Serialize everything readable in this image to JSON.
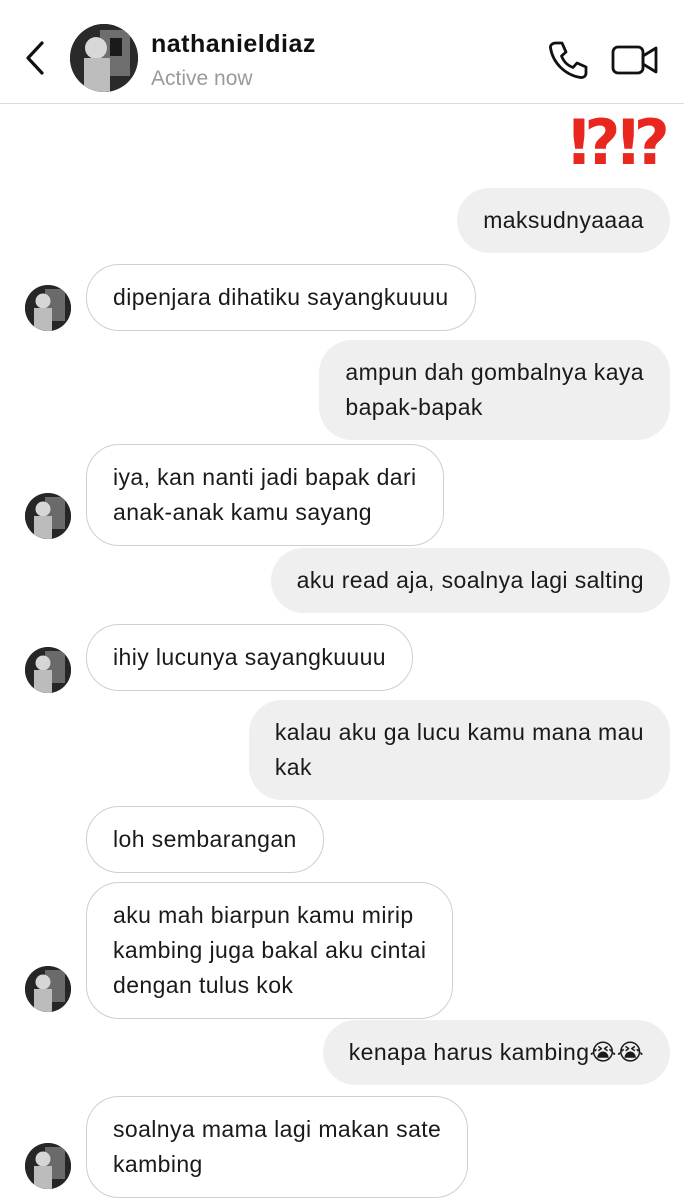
{
  "header": {
    "contact_name": "nathanieldiaz",
    "status": "Active now"
  },
  "reaction": "⁉⁉",
  "messages": [
    {
      "side": "out",
      "text": "maksudnyaaaa"
    },
    {
      "side": "in",
      "text": "dipenjara dihatiku sayangkuuuu"
    },
    {
      "side": "out",
      "text": "ampun dah gombalnya kaya\nbapak-bapak"
    },
    {
      "side": "in",
      "text": "iya, kan nanti jadi bapak dari\nanak-anak kamu sayang"
    },
    {
      "side": "out",
      "text": "aku read aja, soalnya lagi salting"
    },
    {
      "side": "in",
      "text": "ihiy lucunya sayangkuuuu"
    },
    {
      "side": "out",
      "text": "kalau aku ga lucu kamu mana mau\nkak"
    },
    {
      "side": "in",
      "text": "loh sembarangan"
    },
    {
      "side": "in",
      "text": "aku mah biarpun kamu mirip\nkambing juga bakal aku cintai\ndengan tulus kok"
    },
    {
      "side": "out",
      "text": "kenapa harus kambing😭😭"
    },
    {
      "side": "in",
      "text": "soalnya mama lagi makan sate\nkambing"
    }
  ],
  "colors": {
    "outgoing_bubble": "#efefef",
    "incoming_border": "#cfcfcf",
    "reaction": "#e8281f",
    "status_text": "#9a9a9a"
  },
  "icons": [
    "chevron-left-icon",
    "phone-icon",
    "video-camera-icon"
  ]
}
